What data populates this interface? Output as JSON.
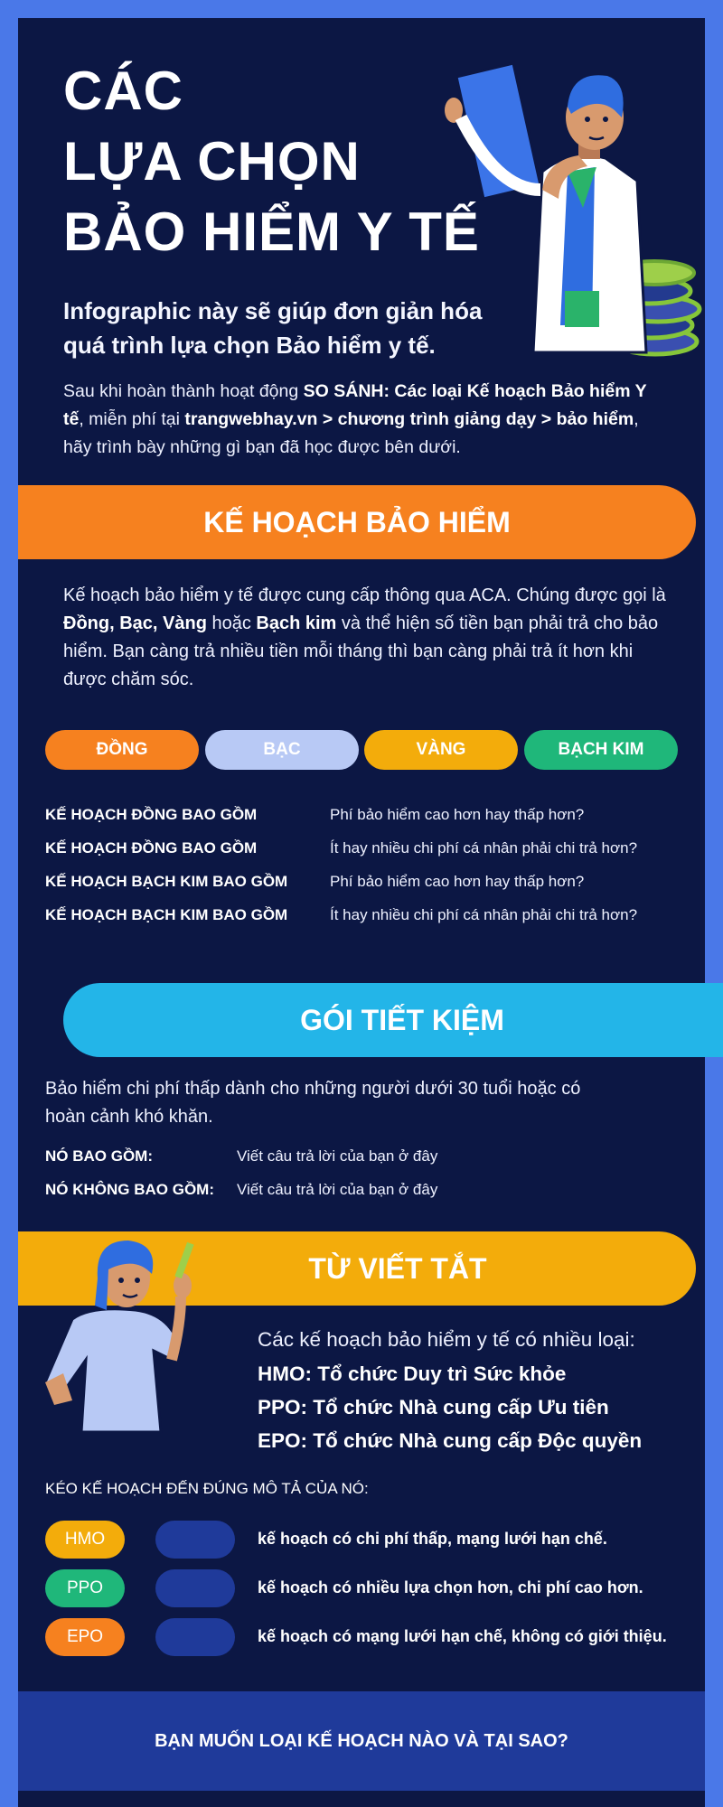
{
  "header": {
    "title_lines": [
      "CÁC",
      "LỰA CHỌN",
      "BẢO HIỂM Y TẾ"
    ],
    "intro": "Infographic này sẽ giúp đơn giản hóa quá trình lựa chọn Bảo hiểm y tế.",
    "desc": {
      "part1": "Sau khi hoàn thành hoạt động ",
      "bold1": "SO SÁNH: Các loại Kế hoạch Bảo hiểm Y tế",
      "part2": ", miễn phí tại ",
      "bold2": "trangwebhay.vn > chương trình giảng dạy > bảo hiểm",
      "part3": ", hãy trình bày những gì bạn đã học được bên dưới."
    }
  },
  "plans": {
    "banner": "KẾ HOẠCH BẢO HIỂM",
    "para": {
      "p1": "Kế hoạch bảo hiểm y tế được cung cấp thông qua ACA. Chúng được gọi là ",
      "b1": "Đồng, Bạc, Vàng",
      "p2": " hoặc ",
      "b2": "Bạch kim",
      "p3": " và thể hiện số tiền bạn phải trả cho bảo hiểm. Bạn càng trả nhiều tiền mỗi tháng thì bạn càng phải trả ít hơn khi được chăm sóc."
    },
    "tiers": [
      {
        "label": "ĐỒNG",
        "color": "#f6811f"
      },
      {
        "label": "BẠC",
        "color": "#b8c9f5"
      },
      {
        "label": "VÀNG",
        "color": "#f3ac0b"
      },
      {
        "label": "BẠCH KIM",
        "color": "#1fb77a"
      }
    ],
    "rows": [
      {
        "label": "KẾ HOẠCH ĐỒNG BAO GỒM",
        "text": "Phí bảo hiểm cao hơn hay thấp hơn?"
      },
      {
        "label": "KẾ HOẠCH ĐỒNG BAO GỒM",
        "text": "Ít hay nhiều chi phí cá nhân phải chi trả hơn?"
      },
      {
        "label": "KẾ HOẠCH BẠCH KIM BAO GỒM",
        "text": "Phí bảo hiểm cao hơn hay thấp hơn?"
      },
      {
        "label": "KẾ HOẠCH BẠCH KIM BAO GỒM",
        "text": "Ít hay nhiều chi phí cá nhân phải chi trả hơn?"
      }
    ]
  },
  "savings": {
    "banner": "GÓI TIẾT KIỆM",
    "desc": "Bảo hiểm chi phí thấp dành cho những người dưới 30 tuổi hoặc có hoàn cảnh khó khăn.",
    "rows": [
      {
        "label": "NÓ BAO GỒM:",
        "text": "Viết câu trả lời của bạn ở đây"
      },
      {
        "label": "NÓ KHÔNG BAO GỒM:",
        "text": "Viết câu trả lời của bạn ở đây"
      }
    ]
  },
  "abbr": {
    "banner": "TỪ VIẾT TẮT",
    "intro": "Các kế hoạch bảo hiểm y tế có nhiều loại:",
    "lines": [
      "HMO: Tổ chức Duy trì Sức khỏe",
      "PPO: Tổ chức Nhà cung cấp Ưu tiên",
      "EPO: Tổ chức Nhà cung cấp Độc quyền"
    ],
    "drag_title": "KÉO KẾ HOẠCH ĐẾN ĐÚNG MÔ TẢ CỦA NÓ:",
    "matches": [
      {
        "tag": "HMO",
        "color": "#f3ac0b",
        "text": "kế hoạch có chi phí thấp, mạng lưới hạn chế."
      },
      {
        "tag": "PPO",
        "color": "#1fb77a",
        "text": "kế hoạch có nhiều lựa chọn hơn, chi phí cao hơn."
      },
      {
        "tag": "EPO",
        "color": "#f6811f",
        "text": "kế hoạch có mạng lưới hạn chế, không có giới thiệu."
      }
    ]
  },
  "footer": {
    "question": "BẠN MUỐN LOẠI KẾ HOẠCH NÀO VÀ TẠI SAO?"
  }
}
